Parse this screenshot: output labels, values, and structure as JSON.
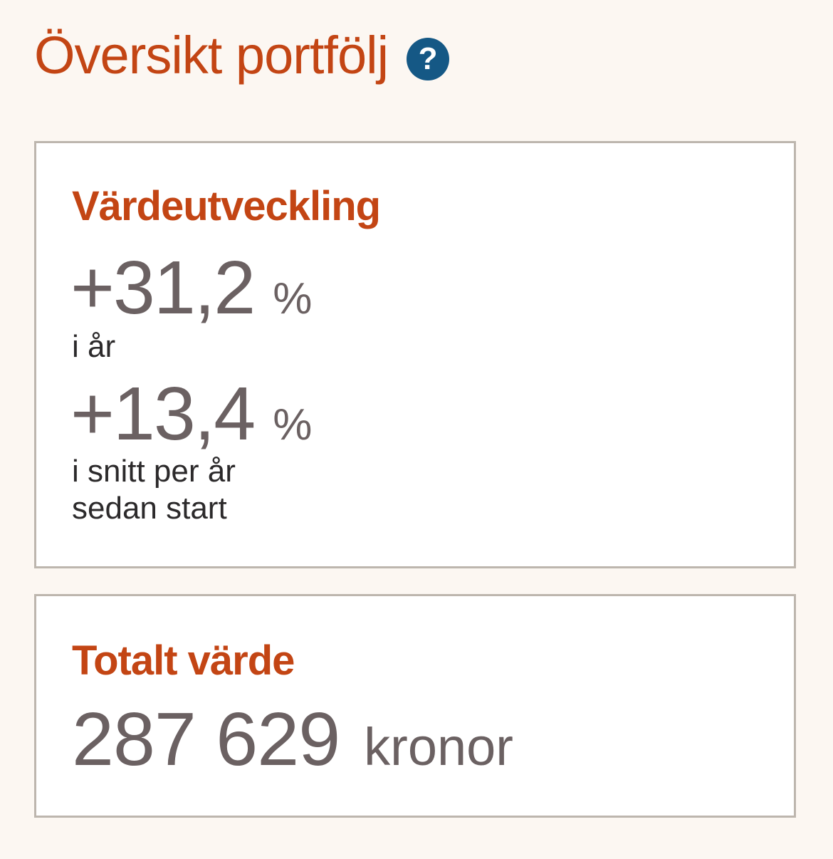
{
  "header": {
    "title": "Översikt portfölj",
    "help_icon": "question-mark-icon",
    "help_symbol": "?"
  },
  "performance_card": {
    "heading": "Värdeutveckling",
    "ytd": {
      "value": "+31,2",
      "unit": "%",
      "caption": "i år"
    },
    "average": {
      "value": "+13,4",
      "unit": "%",
      "caption_line1": "i snitt per år",
      "caption_line2": "sedan start"
    }
  },
  "total_card": {
    "heading": "Totalt värde",
    "value": "287 629",
    "unit": "kronor"
  },
  "colors": {
    "accent": "#c34514",
    "help_icon_bg": "#155885",
    "value_text": "#6b6162",
    "caption_text": "#2c2a2b",
    "page_bg": "#fcf7f2",
    "card_border": "#bdb6ae"
  }
}
